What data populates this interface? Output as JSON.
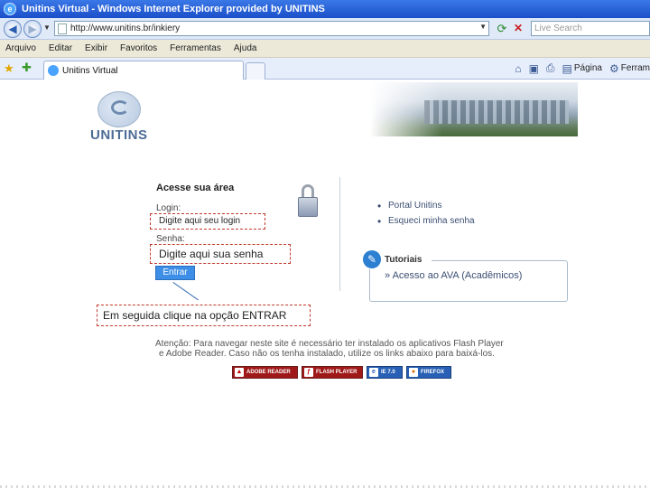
{
  "window": {
    "title": "Unitins Virtual - Windows Internet Explorer provided by UNITINS"
  },
  "address_bar": {
    "url": "http://www.unitins.br/inkiery",
    "search_placeholder": "Live Search"
  },
  "menu": {
    "items": [
      "Arquivo",
      "Editar",
      "Exibir",
      "Favoritos",
      "Ferramentas",
      "Ajuda"
    ]
  },
  "tabs": {
    "active_label": "Unitins Virtual"
  },
  "toolbar_right": {
    "page_label": "Página",
    "tools_label": "Ferram"
  },
  "site": {
    "logo_text": "UNITINS"
  },
  "login": {
    "title": "Acesse sua área",
    "login_label": "Login:",
    "login_value": "Digite aqui  seu  login",
    "senha_label": "Senha:",
    "senha_value": "Digite aqui  sua senha",
    "entrar_label": "Entrar"
  },
  "callout": {
    "text": "Em seguida clique na opção ENTRAR"
  },
  "links": {
    "items": [
      "Portal Unitins",
      "Esqueci minha senha"
    ]
  },
  "tutoriais": {
    "title": "Tutoriais",
    "link": "» Acesso ao AVA (Acadêmicos)"
  },
  "notice": {
    "line1": "Atenção: Para navegar neste site é necessário ter instalado os aplicativos Flash Player",
    "line2": "e Adobe Reader. Caso não os tenha instalado, utilize os links abaixo para baixá-los."
  },
  "plugins": {
    "items": [
      "ADOBE READER",
      "FLASH PLAYER",
      "IE 7.0",
      "FIREFOX"
    ]
  },
  "colors": {
    "accent": "#3d8ee6",
    "titlebar": "#1a4fc9",
    "annotation": "#c0392b"
  }
}
